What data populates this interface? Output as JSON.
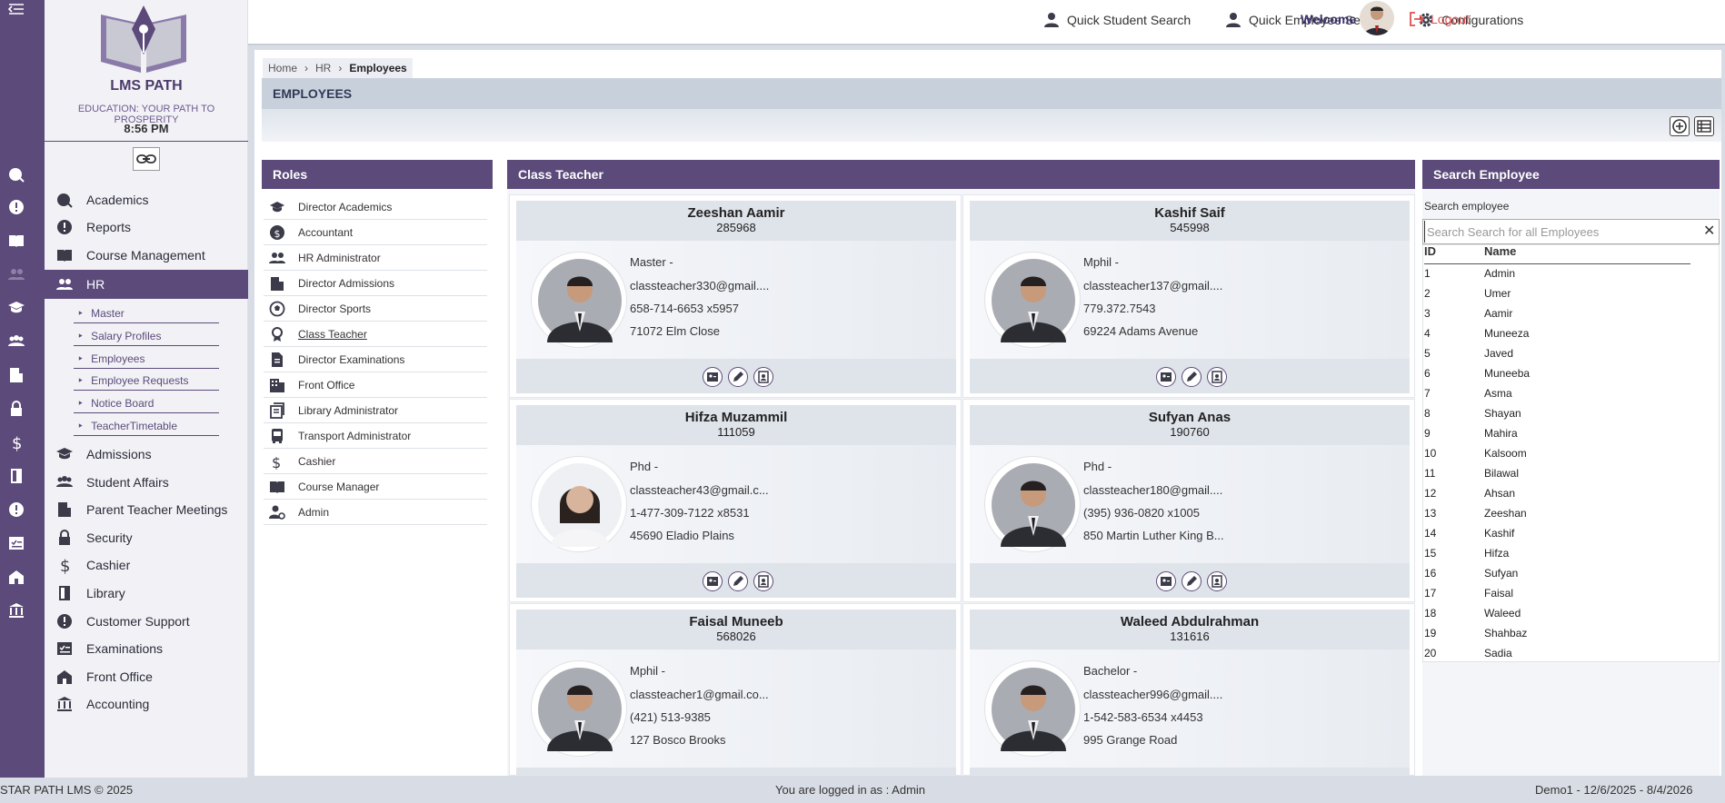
{
  "app": {
    "brand": "LMS PATH",
    "tagline": "EDUCATION: YOUR PATH TO PROSPERITY",
    "clock": "8:56 PM"
  },
  "topbar": {
    "quick_student": "Quick Student Search",
    "quick_employee": "Quick Employee Search",
    "configurations": "Configurations",
    "welcome": "Welcome",
    "logout": "Logout"
  },
  "nav": {
    "academics": "Academics",
    "reports": "Reports",
    "course_management": "Course Management",
    "hr": "HR",
    "hr_sub": [
      "Master",
      "Salary Profiles",
      "Employees",
      "Employee Requests",
      "Notice Board",
      "TeacherTimetable"
    ],
    "admissions": "Admissions",
    "student_affairs": "Student Affairs",
    "ptm": "Parent Teacher Meetings",
    "security": "Security",
    "cashier": "Cashier",
    "library": "Library",
    "customer_support": "Customer Support",
    "examinations": "Examinations",
    "front_office": "Front Office",
    "accounting": "Accounting"
  },
  "breadcrumb": {
    "home": "Home",
    "hr": "HR",
    "current": "Employees"
  },
  "page_title": "EMPLOYEES",
  "roles": {
    "title": "Roles",
    "items": [
      "Director Academics",
      "Accountant",
      "HR Administrator",
      "Director Admissions",
      "Director Sports",
      "Class Teacher",
      "Director Examinations",
      "Front Office",
      "Library Administrator",
      "Transport Administrator",
      "Cashier",
      "Course Manager",
      "Admin"
    ]
  },
  "cards_title": "Class Teacher",
  "employees": [
    {
      "name": "Zeeshan Aamir",
      "id": "285968",
      "degree": "Master -",
      "email": "classteacher330@gmail....",
      "phone": "658-714-6653 x5957",
      "address": "71072 Elm Close"
    },
    {
      "name": "Kashif Saif",
      "id": "545998",
      "degree": "Mphil -",
      "email": "classteacher137@gmail....",
      "phone": "779.372.7543",
      "address": "69224 Adams Avenue"
    },
    {
      "name": "Hifza Muzammil",
      "id": "111059",
      "degree": "Phd -",
      "email": "classteacher43@gmail.c...",
      "phone": "1-477-309-7122 x8531",
      "address": "45690 Eladio Plains"
    },
    {
      "name": "Sufyan Anas",
      "id": "190760",
      "degree": "Phd -",
      "email": "classteacher180@gmail....",
      "phone": "(395) 936-0820 x1005",
      "address": "850 Martin Luther King B..."
    },
    {
      "name": "Faisal Muneeb",
      "id": "568026",
      "degree": "Mphil -",
      "email": "classteacher1@gmail.co...",
      "phone": "(421) 513-9385",
      "address": "127 Bosco Brooks"
    },
    {
      "name": "Waleed Abdulrahman",
      "id": "131616",
      "degree": "Bachelor -",
      "email": "classteacher996@gmail....",
      "phone": "1-542-583-6534 x4453",
      "address": "995 Grange Road"
    }
  ],
  "search": {
    "title": "Search Employee",
    "label": "Search employee",
    "placeholder": "Search Search for all Employees",
    "col_id": "ID",
    "col_name": "Name",
    "rows": [
      [
        "1",
        "Admin"
      ],
      [
        "2",
        "Umer"
      ],
      [
        "3",
        "Aamir"
      ],
      [
        "4",
        "Muneeza"
      ],
      [
        "5",
        "Javed"
      ],
      [
        "6",
        "Muneeba"
      ],
      [
        "7",
        "Asma"
      ],
      [
        "8",
        "Shayan"
      ],
      [
        "9",
        "Mahira"
      ],
      [
        "10",
        "Kalsoom"
      ],
      [
        "11",
        "Bilawal"
      ],
      [
        "12",
        "Ahsan"
      ],
      [
        "13",
        "Zeeshan"
      ],
      [
        "14",
        "Kashif"
      ],
      [
        "15",
        "Hifza"
      ],
      [
        "16",
        "Sufyan"
      ],
      [
        "17",
        "Faisal"
      ],
      [
        "18",
        "Waleed"
      ],
      [
        "19",
        "Shahbaz"
      ],
      [
        "20",
        "Sadia"
      ]
    ]
  },
  "footer": {
    "copyright": "STAR PATH LMS © 2025",
    "logged_in": "You are logged in as : Admin",
    "session": "Demo1 -  12/6/2025 - 8/4/2026"
  },
  "colors": {
    "brand": "#5b4a7a",
    "logout": "#e05050"
  }
}
